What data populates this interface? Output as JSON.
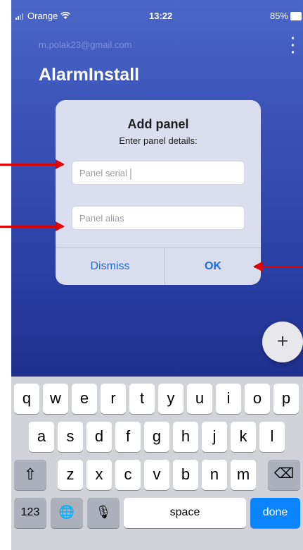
{
  "status_bar": {
    "carrier": "Orange",
    "time": "13:22",
    "battery": "85%"
  },
  "header": {
    "account_email": "m.polak23@gmail.com",
    "app_title": "AlarmInstall",
    "more_icon": "kebab-menu-icon"
  },
  "dialog": {
    "title": "Add panel",
    "subtitle": "Enter panel details:",
    "serial_placeholder": "Panel serial",
    "alias_placeholder": "Panel alias",
    "dismiss_label": "Dismiss",
    "ok_label": "OK"
  },
  "fab": {
    "label": "+"
  },
  "keyboard": {
    "row1": [
      "q",
      "w",
      "e",
      "r",
      "t",
      "y",
      "u",
      "i",
      "o",
      "p"
    ],
    "row2": [
      "a",
      "s",
      "d",
      "f",
      "g",
      "h",
      "j",
      "k",
      "l"
    ],
    "row3": [
      "z",
      "x",
      "c",
      "v",
      "b",
      "n",
      "m"
    ],
    "shift_symbol": "⇧",
    "backspace_symbol": "⌫",
    "numbers_label": "123",
    "globe_symbol": "🌐",
    "mic_symbol": "🎙",
    "space_label": "space",
    "done_label": "done"
  },
  "annotation_color": "#e00000"
}
